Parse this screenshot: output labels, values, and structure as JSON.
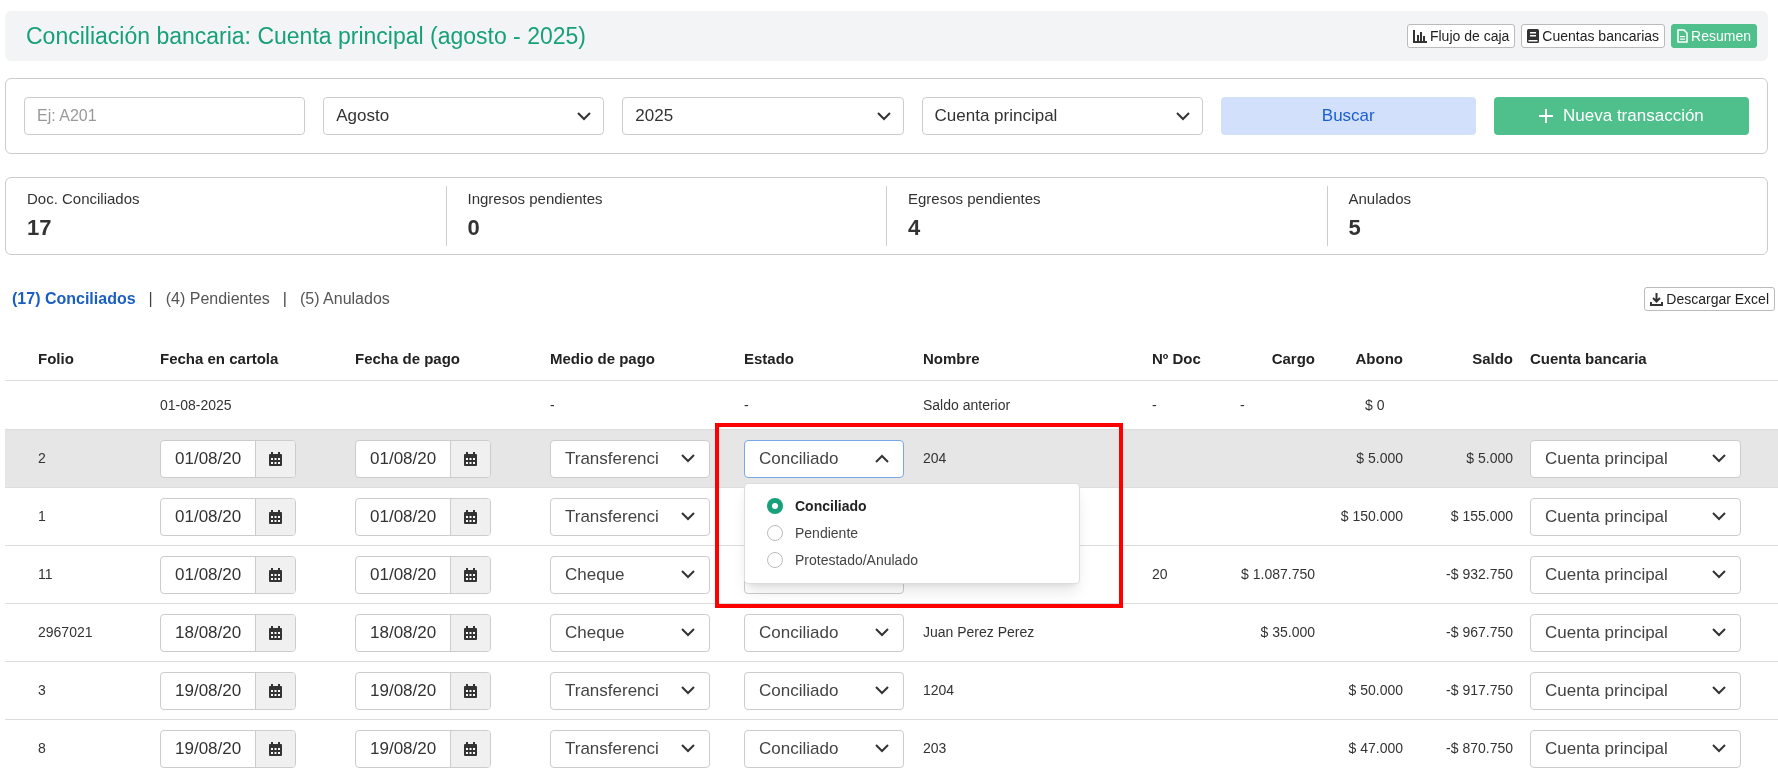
{
  "header": {
    "title": "Conciliación bancaria: Cuenta principal (agosto - 2025)",
    "buttons": [
      {
        "label": "Flujo de caja",
        "kind": "chart",
        "primary": false
      },
      {
        "label": "Cuentas bancarias",
        "kind": "book",
        "primary": false
      },
      {
        "label": "Resumen",
        "kind": "doc",
        "primary": true
      }
    ]
  },
  "filters": {
    "search": {
      "placeholder": "Ej: A201"
    },
    "month": "Agosto",
    "year": "2025",
    "account": "Cuenta principal",
    "search_button": "Buscar",
    "new_button": "Nueva transacción"
  },
  "stats": [
    {
      "label": "Doc. Conciliados",
      "value": "17"
    },
    {
      "label": "Ingresos pendientes",
      "value": "0"
    },
    {
      "label": "Egresos pendientes",
      "value": "4"
    },
    {
      "label": "Anulados",
      "value": "5"
    }
  ],
  "tabs": [
    {
      "label": "(17) Conciliados",
      "selected": true
    },
    {
      "label": "(4) Pendientes",
      "selected": false
    },
    {
      "label": "(5) Anulados",
      "selected": false
    }
  ],
  "tab_separator": "|",
  "download_button": "Descargar Excel",
  "table": {
    "columns": [
      "Folio",
      "Fecha en cartola",
      "Fecha de pago",
      "Medio de pago",
      "Estado",
      "Nombre",
      "Nº Doc",
      "Cargo",
      "Abono",
      "Saldo",
      "Cuenta bancaria"
    ],
    "rows": [
      {
        "kind": "opening",
        "fecha_cartola": "01-08-2025",
        "medio": "-",
        "estado": "-",
        "nombre": "Saldo anterior",
        "n_doc": "-",
        "cargo": "-",
        "abono": "$ 0"
      },
      {
        "kind": "transaction",
        "selected": true,
        "folio": "2",
        "fecha_cartola": "01/08/20",
        "fecha_pago": "01/08/20",
        "medio": "Transferenci",
        "estado": "Conciliado",
        "estado_open": true,
        "nombre": "204",
        "abono": "$ 5.000",
        "saldo": "$ 5.000",
        "cuenta": "Cuenta principal",
        "estado_options": [
          {
            "label": "Conciliado",
            "selected": true
          },
          {
            "label": "Pendiente",
            "selected": false
          },
          {
            "label": "Protestado/Anulado",
            "selected": false
          }
        ]
      },
      {
        "kind": "transaction",
        "selected": false,
        "folio": "1",
        "fecha_cartola": "01/08/20",
        "fecha_pago": "01/08/20",
        "medio": "Transferenci",
        "abono": "$ 150.000",
        "saldo": "$ 155.000",
        "cuenta": "Cuenta principal"
      },
      {
        "kind": "transaction",
        "selected": false,
        "folio": "11",
        "fecha_cartola": "01/08/20",
        "fecha_pago": "01/08/20",
        "medio": "Cheque",
        "n_doc": "20",
        "cargo": "$ 1.087.750",
        "saldo": "-$ 932.750",
        "cuenta": "Cuenta principal"
      },
      {
        "kind": "transaction",
        "selected": false,
        "folio": "2967021",
        "fecha_cartola": "18/08/20",
        "fecha_pago": "18/08/20",
        "medio": "Cheque",
        "estado": "Conciliado",
        "nombre": "Juan Perez Perez",
        "cargo": "$ 35.000",
        "saldo": "-$ 967.750",
        "cuenta": "Cuenta principal"
      },
      {
        "kind": "transaction",
        "selected": false,
        "folio": "3",
        "fecha_cartola": "19/08/20",
        "fecha_pago": "19/08/20",
        "medio": "Transferenci",
        "estado": "Conciliado",
        "nombre": "1204",
        "abono": "$ 50.000",
        "saldo": "-$ 917.750",
        "cuenta": "Cuenta principal"
      },
      {
        "kind": "transaction",
        "selected": false,
        "folio": "8",
        "fecha_cartola": "19/08/20",
        "fecha_pago": "19/08/20",
        "medio": "Transferenci",
        "estado": "Conciliado",
        "nombre": "203",
        "abono": "$ 47.000",
        "saldo": "-$ 870.750",
        "cuenta": "Cuenta principal"
      }
    ]
  },
  "annotation": {
    "kind": "highlight-frame"
  }
}
